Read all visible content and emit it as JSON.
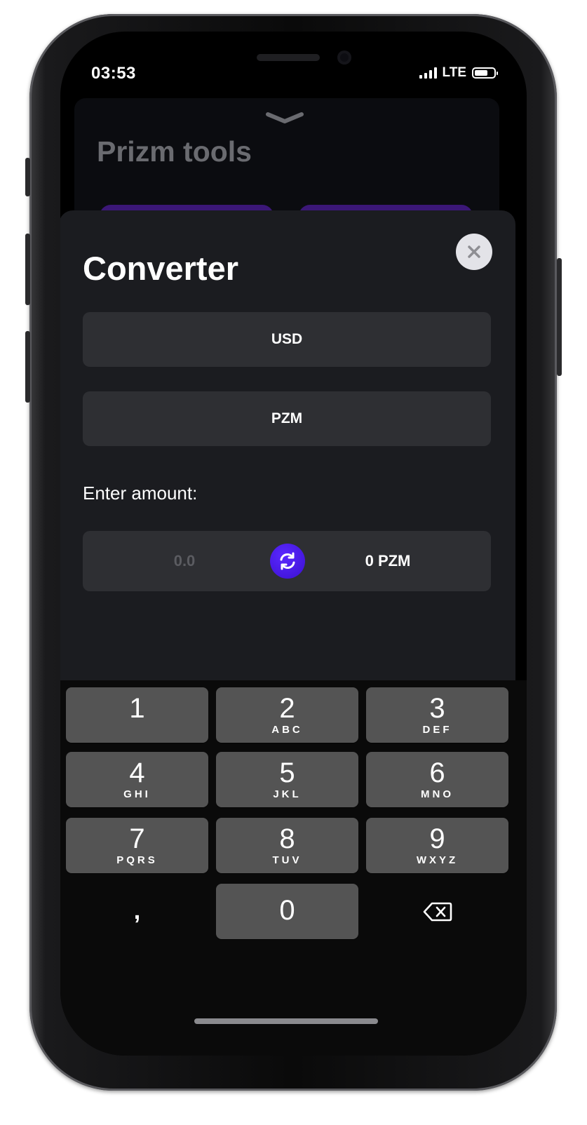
{
  "status_bar": {
    "time": "03:53",
    "network": "LTE",
    "icons": [
      "signal-icon",
      "battery-icon"
    ]
  },
  "background_sheet": {
    "title": "Prizm tools"
  },
  "modal": {
    "title": "Converter",
    "close_icon": "close-icon",
    "from_currency": "USD",
    "to_currency": "PZM",
    "enter_amount_label": "Enter amount:",
    "amount_placeholder": "0.0",
    "result": "0 PZM",
    "swap_icon": "swap-icon"
  },
  "keypad": {
    "keys": [
      {
        "digit": "1",
        "letters": ""
      },
      {
        "digit": "2",
        "letters": "ABC"
      },
      {
        "digit": "3",
        "letters": "DEF"
      },
      {
        "digit": "4",
        "letters": "GHI"
      },
      {
        "digit": "5",
        "letters": "JKL"
      },
      {
        "digit": "6",
        "letters": "MNO"
      },
      {
        "digit": "7",
        "letters": "PQRS"
      },
      {
        "digit": "8",
        "letters": "TUV"
      },
      {
        "digit": "9",
        "letters": "WXYZ"
      },
      {
        "digit": "0",
        "letters": ""
      }
    ],
    "comma": ",",
    "delete_icon": "backspace-icon"
  },
  "colors": {
    "accent": "#4a1ee8",
    "modal_bg": "#1b1c20",
    "field_bg": "#2e2f33",
    "key_bg": "#545454"
  }
}
